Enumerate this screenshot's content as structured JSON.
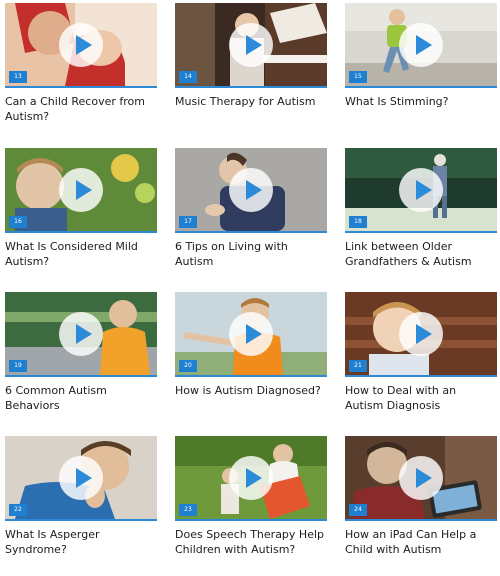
{
  "videos": [
    {
      "number": "13",
      "title": "Can a Child Recover from Autism?",
      "thumbnail": "child-hugging-parent-photo",
      "bg": "#e9c3a6",
      "fg": "#c3302c"
    },
    {
      "number": "14",
      "title": "Music Therapy for Autism",
      "thumbnail": "boy-at-piano-photo",
      "bg": "#3b2a21",
      "fg": "#dcd6cf"
    },
    {
      "number": "15",
      "title": "What Is Stimming?",
      "thumbnail": "boy-running-outdoors-photo",
      "bg": "#c9c4bb",
      "fg": "#9bc53d"
    },
    {
      "number": "16",
      "title": "What Is Considered Mild Autism?",
      "thumbnail": "boy-in-garden-photo",
      "bg": "#5f8a3a",
      "fg": "#e2c5a6"
    },
    {
      "number": "17",
      "title": "6 Tips on Living with Autism",
      "thumbnail": "boy-clapping-hands-photo",
      "bg": "#aaa8a4",
      "fg": "#2f3c5e"
    },
    {
      "number": "18",
      "title": "Link between Older Grandfathers & Autism",
      "thumbnail": "grandfather-by-lake-photo",
      "bg": "#1f3b2e",
      "fg": "#6b84a6"
    },
    {
      "number": "19",
      "title": "6 Common Autism Behaviors",
      "thumbnail": "crying-child-on-bridge-photo",
      "bg": "#3c6b3f",
      "fg": "#f2a12a"
    },
    {
      "number": "20",
      "title": "How is Autism Diagnosed?",
      "thumbnail": "boy-pointing-photo",
      "bg": "#b9c7cf",
      "fg": "#f08b1c"
    },
    {
      "number": "21",
      "title": "How to Deal with an Autism Diagnosis",
      "thumbnail": "smiling-boy-on-bench-photo",
      "bg": "#6a3a24",
      "fg": "#f0d2b6"
    },
    {
      "number": "22",
      "title": "What Is Asperger Syndrome?",
      "thumbnail": "sad-boy-closeup-photo",
      "bg": "#d9d2c9",
      "fg": "#2c6fb1"
    },
    {
      "number": "23",
      "title": "Does Speech Therapy Help Children with Autism?",
      "thumbnail": "reading-book-in-park-photo",
      "bg": "#6f9a3c",
      "fg": "#e4572e"
    },
    {
      "number": "24",
      "title": "How an iPad Can Help a Child with Autism",
      "thumbnail": "child-with-ipad-photo",
      "bg": "#5a3e2d",
      "fg": "#d4b79a"
    }
  ],
  "colors": {
    "accent": "#2d8ad6",
    "play_icon": "#2b8bd8",
    "number_badge": "#1f7fd0"
  }
}
